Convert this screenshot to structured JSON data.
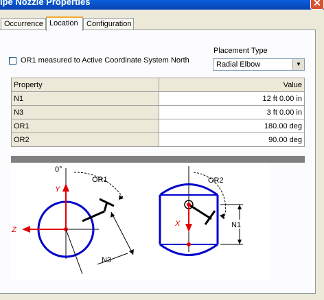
{
  "window": {
    "title": "ipe Nozzle Properties",
    "close_glyph": "✕"
  },
  "tabs": [
    {
      "label": "Occurrence",
      "active": false
    },
    {
      "label": "Location",
      "active": true
    },
    {
      "label": "Configuration",
      "active": false
    }
  ],
  "options": {
    "or1_checkbox_label": "OR1 measured to Active Coordinate System North",
    "or1_checked": false
  },
  "placement": {
    "label": "Placement Type",
    "selected": "Radial Elbow"
  },
  "grid": {
    "headers": {
      "property": "Property",
      "value": "Value"
    },
    "rows": [
      {
        "property": "N1",
        "value": "12 ft  0.00 in"
      },
      {
        "property": "N3",
        "value": "3 ft  0.00 in"
      },
      {
        "property": "OR1",
        "value": "180.00 deg"
      },
      {
        "property": "OR2",
        "value": "90.00 deg"
      }
    ]
  },
  "diagram": {
    "labels": {
      "zero": "0°",
      "or1": "OR1",
      "or2": "OR2",
      "y_axis": "Y",
      "z_axis": "Z",
      "x_axis": "X",
      "n1": "N1",
      "n3": "N3"
    },
    "colors": {
      "vessel": "#0000cc",
      "axis": "#e00000",
      "line": "#000000"
    }
  }
}
